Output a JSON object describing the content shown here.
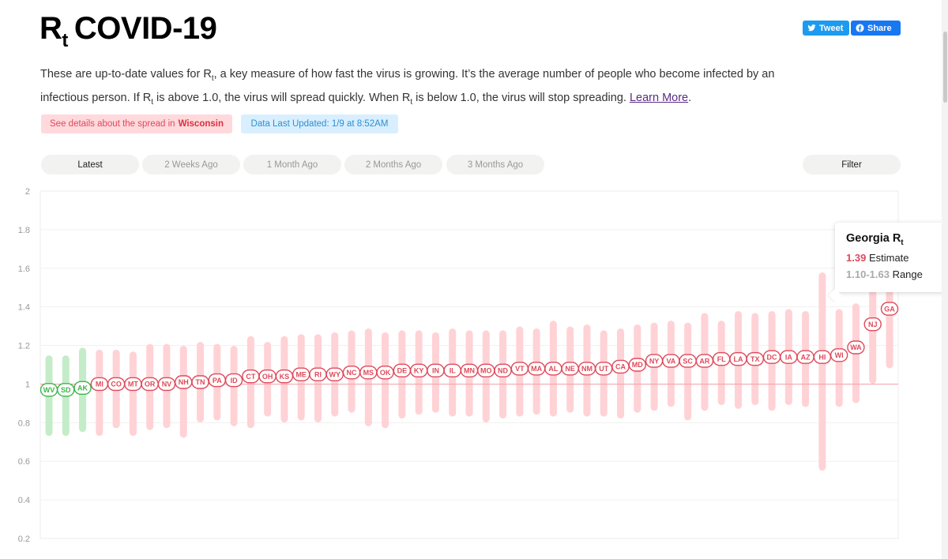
{
  "header": {
    "title_main": "R",
    "title_sub": "t",
    "title_rest": "COVID-19",
    "tweet_label": "Tweet",
    "share_label": "Share"
  },
  "intro": {
    "p1": "These are up-to-date values for R",
    "sub1": "t",
    "p2": ", a key measure of how fast the virus is growing. It’s the average number of people who become infected by an infectious person. If R",
    "sub2": "t",
    "p3": " is above 1.0, the virus will spread quickly. When R",
    "sub3": "t",
    "p4": " is below 1.0, the virus will stop spreading. ",
    "link": "Learn More",
    "end": "."
  },
  "badges": {
    "details_prefix": "See details about the spread in",
    "details_state": "Wisconsin",
    "updated": "Data Last Updated: 1/9 at 8:52AM"
  },
  "tabs": [
    {
      "label": "Latest",
      "active": true
    },
    {
      "label": "2 Weeks Ago",
      "active": false
    },
    {
      "label": "1 Month Ago",
      "active": false
    },
    {
      "label": "2 Months Ago",
      "active": false
    },
    {
      "label": "3 Months Ago",
      "active": false
    }
  ],
  "filter_label": "Filter",
  "tooltip": {
    "state": "Georgia R",
    "sub": "t",
    "estimate": "1.39",
    "estimate_label": "Estimate",
    "range": "1.10-1.63",
    "range_label": "Range"
  },
  "colors": {
    "below": "#3cb54a",
    "below_bar": "#c4ecc8",
    "above": "#e0495a",
    "above_bar": "#ffd2d6"
  },
  "chart_data": {
    "type": "scatter",
    "title": "",
    "xlabel": "",
    "ylabel": "",
    "ylim": [
      0.2,
      2.0
    ],
    "yticks": [
      "2",
      "1.8",
      "1.6",
      "1.4",
      "1.2",
      "1",
      "0.8",
      "0.6",
      "0.4",
      "0.2"
    ],
    "reference_line": 1.0,
    "states": [
      {
        "code": "WV",
        "rt": 0.97,
        "low": 0.75,
        "high": 1.13
      },
      {
        "code": "SD",
        "rt": 0.97,
        "low": 0.75,
        "high": 1.13
      },
      {
        "code": "AK",
        "rt": 0.98,
        "low": 0.77,
        "high": 1.17
      },
      {
        "code": "MI",
        "rt": 1.0,
        "low": 0.75,
        "high": 1.16
      },
      {
        "code": "CO",
        "rt": 1.0,
        "low": 0.79,
        "high": 1.16
      },
      {
        "code": "MT",
        "rt": 1.0,
        "low": 0.75,
        "high": 1.15
      },
      {
        "code": "OR",
        "rt": 1.0,
        "low": 0.78,
        "high": 1.19
      },
      {
        "code": "NV",
        "rt": 1.0,
        "low": 0.79,
        "high": 1.19
      },
      {
        "code": "NH",
        "rt": 1.01,
        "low": 0.74,
        "high": 1.18
      },
      {
        "code": "TN",
        "rt": 1.01,
        "low": 0.82,
        "high": 1.2
      },
      {
        "code": "PA",
        "rt": 1.02,
        "low": 0.83,
        "high": 1.19
      },
      {
        "code": "ID",
        "rt": 1.02,
        "low": 0.8,
        "high": 1.18
      },
      {
        "code": "CT",
        "rt": 1.04,
        "low": 0.79,
        "high": 1.23
      },
      {
        "code": "OH",
        "rt": 1.04,
        "low": 0.85,
        "high": 1.2
      },
      {
        "code": "KS",
        "rt": 1.04,
        "low": 0.82,
        "high": 1.23
      },
      {
        "code": "ME",
        "rt": 1.05,
        "low": 0.83,
        "high": 1.24
      },
      {
        "code": "RI",
        "rt": 1.05,
        "low": 0.82,
        "high": 1.24
      },
      {
        "code": "WY",
        "rt": 1.05,
        "low": 0.85,
        "high": 1.25
      },
      {
        "code": "NC",
        "rt": 1.06,
        "low": 0.87,
        "high": 1.26
      },
      {
        "code": "MS",
        "rt": 1.06,
        "low": 0.8,
        "high": 1.27
      },
      {
        "code": "OK",
        "rt": 1.06,
        "low": 0.79,
        "high": 1.25
      },
      {
        "code": "DE",
        "rt": 1.07,
        "low": 0.84,
        "high": 1.26
      },
      {
        "code": "KY",
        "rt": 1.07,
        "low": 0.86,
        "high": 1.26
      },
      {
        "code": "IN",
        "rt": 1.07,
        "low": 0.87,
        "high": 1.25
      },
      {
        "code": "IL",
        "rt": 1.07,
        "low": 0.85,
        "high": 1.27
      },
      {
        "code": "MN",
        "rt": 1.07,
        "low": 0.85,
        "high": 1.26
      },
      {
        "code": "MO",
        "rt": 1.07,
        "low": 0.82,
        "high": 1.26
      },
      {
        "code": "ND",
        "rt": 1.07,
        "low": 0.84,
        "high": 1.26
      },
      {
        "code": "VT",
        "rt": 1.08,
        "low": 0.85,
        "high": 1.28
      },
      {
        "code": "MA",
        "rt": 1.08,
        "low": 0.86,
        "high": 1.27
      },
      {
        "code": "AL",
        "rt": 1.08,
        "low": 0.85,
        "high": 1.31
      },
      {
        "code": "NE",
        "rt": 1.08,
        "low": 0.87,
        "high": 1.28
      },
      {
        "code": "NM",
        "rt": 1.08,
        "low": 0.85,
        "high": 1.29
      },
      {
        "code": "UT",
        "rt": 1.08,
        "low": 0.85,
        "high": 1.26
      },
      {
        "code": "CA",
        "rt": 1.09,
        "low": 0.84,
        "high": 1.27
      },
      {
        "code": "MD",
        "rt": 1.1,
        "low": 0.87,
        "high": 1.29
      },
      {
        "code": "NY",
        "rt": 1.12,
        "low": 0.88,
        "high": 1.3
      },
      {
        "code": "VA",
        "rt": 1.12,
        "low": 0.9,
        "high": 1.31
      },
      {
        "code": "SC",
        "rt": 1.12,
        "low": 0.83,
        "high": 1.3
      },
      {
        "code": "AR",
        "rt": 1.12,
        "low": 0.88,
        "high": 1.35
      },
      {
        "code": "FL",
        "rt": 1.13,
        "low": 0.91,
        "high": 1.31
      },
      {
        "code": "LA",
        "rt": 1.13,
        "low": 0.89,
        "high": 1.36
      },
      {
        "code": "TX",
        "rt": 1.13,
        "low": 0.91,
        "high": 1.35
      },
      {
        "code": "DC",
        "rt": 1.14,
        "low": 0.88,
        "high": 1.36
      },
      {
        "code": "IA",
        "rt": 1.14,
        "low": 0.91,
        "high": 1.37
      },
      {
        "code": "AZ",
        "rt": 1.14,
        "low": 0.9,
        "high": 1.36
      },
      {
        "code": "HI",
        "rt": 1.14,
        "low": 0.57,
        "high": 1.56
      },
      {
        "code": "WI",
        "rt": 1.15,
        "low": 0.9,
        "high": 1.37
      },
      {
        "code": "WA",
        "rt": 1.19,
        "low": 0.92,
        "high": 1.4
      },
      {
        "code": "NJ",
        "rt": 1.31,
        "low": 1.02,
        "high": 1.55
      },
      {
        "code": "GA",
        "rt": 1.39,
        "low": 1.1,
        "high": 1.63
      }
    ]
  }
}
